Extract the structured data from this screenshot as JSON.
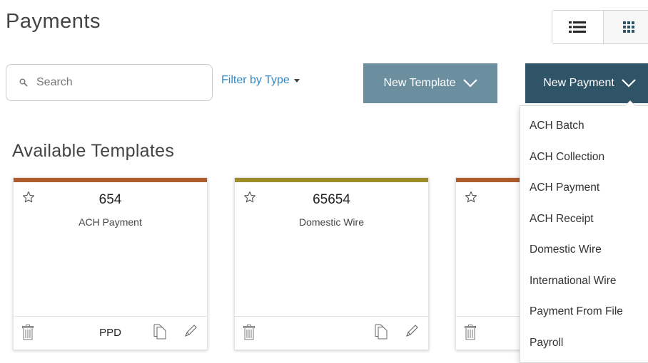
{
  "page": {
    "title": "Payments"
  },
  "view_toggle": {
    "list_icon": "list-icon",
    "grid_icon": "grid-icon"
  },
  "search": {
    "placeholder": "Search",
    "value": "",
    "icon": "search-icon"
  },
  "filter": {
    "label": "Filter by Type"
  },
  "buttons": {
    "new_template": "New Template",
    "new_payment": "New Payment"
  },
  "colors": {
    "new_template_bg": "#6c8f9f",
    "new_payment_bg": "#2f5367",
    "link": "#2f88c4",
    "bar_ach": "#b05b2c",
    "bar_wire": "#9c8c2a"
  },
  "section": {
    "title": "Available Templates"
  },
  "templates": [
    {
      "number": "654",
      "type": "ACH Payment",
      "code": "PPD",
      "bar_color": "#b05b2c"
    },
    {
      "number": "65654",
      "type": "Domestic Wire",
      "code": "",
      "bar_color": "#9c8c2a"
    },
    {
      "number": "",
      "type": "",
      "code": "",
      "bar_color": "#b05b2c"
    }
  ],
  "menu": {
    "items": [
      "ACH Batch",
      "ACH Collection",
      "ACH Payment",
      "ACH Receipt",
      "Domestic Wire",
      "International Wire",
      "Payment From File",
      "Payroll"
    ]
  }
}
